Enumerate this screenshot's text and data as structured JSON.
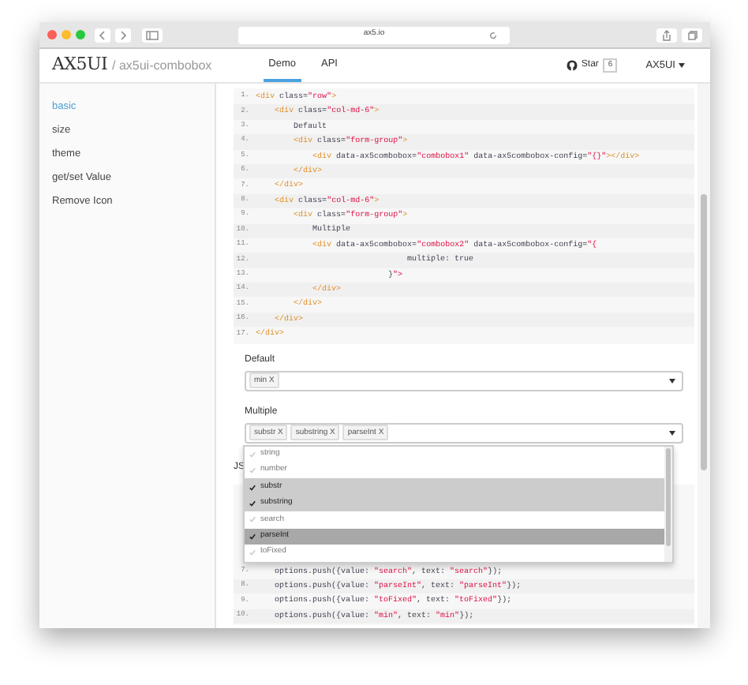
{
  "browser": {
    "url": "ax5.io"
  },
  "nav": {
    "logo": "AX5UI",
    "breadcrumb": "/ ax5ui-combobox",
    "tabs": [
      {
        "label": "Demo",
        "selected": true
      },
      {
        "label": "API",
        "selected": false
      }
    ],
    "star_label": "Star",
    "star_count": "6",
    "menu_label": "AX5UI"
  },
  "sidebar": {
    "items": [
      {
        "label": "basic",
        "selected": true
      },
      {
        "label": "size",
        "selected": false
      },
      {
        "label": "theme",
        "selected": false
      },
      {
        "label": "get/set Value",
        "selected": false
      },
      {
        "label": "Remove Icon",
        "selected": false
      }
    ]
  },
  "html_code": [
    {
      "number": "1.",
      "code": "<div class=\"row\">"
    },
    {
      "number": "2.",
      "code": "    <div class=\"col-md-6\">"
    },
    {
      "number": "3.",
      "code": "        Default"
    },
    {
      "number": "4.",
      "code": "        <div class=\"form-group\">"
    },
    {
      "number": "5.",
      "code": "            <div data-ax5combobox=\"combobox1\" data-ax5combobox-config=\"{}\"></div>"
    },
    {
      "number": "6.",
      "code": "        </div>"
    },
    {
      "number": "7.",
      "code": "    </div>"
    },
    {
      "number": "8.",
      "code": "    <div class=\"col-md-6\">"
    },
    {
      "number": "9.",
      "code": "        <div class=\"form-group\">"
    },
    {
      "number": "10.",
      "code": "            Multiple"
    },
    {
      "number": "11.",
      "code": "            <div data-ax5combobox=\"combobox2\" data-ax5combobox-config=\"{"
    },
    {
      "number": "12.",
      "code": "                                multiple: true"
    },
    {
      "number": "13.",
      "code": "                            }\">"
    },
    {
      "number": "14.",
      "code": "            </div>"
    },
    {
      "number": "15.",
      "code": "        </div>"
    },
    {
      "number": "16.",
      "code": "    </div>"
    },
    {
      "number": "17.",
      "code": "</div>"
    }
  ],
  "default_combobox": {
    "label": "Default",
    "tags": [
      "min X"
    ]
  },
  "multiple_combobox": {
    "label": "Multiple",
    "tags": [
      "substr X",
      "substring X",
      "parseInt X"
    ]
  },
  "js_label": "JS",
  "dropdown": [
    {
      "label": "string",
      "selected": false,
      "focused": false
    },
    {
      "label": "number",
      "selected": false,
      "focused": false
    },
    {
      "label": "substr",
      "selected": true,
      "focused": false
    },
    {
      "label": "substring",
      "selected": true,
      "focused": false
    },
    {
      "label": "search",
      "selected": false,
      "focused": false
    },
    {
      "label": "parseInt",
      "selected": true,
      "focused": true
    },
    {
      "label": "toFixed",
      "selected": false,
      "focused": false
    }
  ],
  "js_code": [
    {
      "number": "7.",
      "code": "    options.push({value: \"search\", text: \"search\"});"
    },
    {
      "number": "8.",
      "code": "    options.push({value: \"parseInt\", text: \"parseInt\"});"
    },
    {
      "number": "9.",
      "code": "    options.push({value: \"toFixed\", text: \"toFixed\"});"
    },
    {
      "number": "10.",
      "code": "    options.push({value: \"min\", text: \"min\"});"
    }
  ]
}
